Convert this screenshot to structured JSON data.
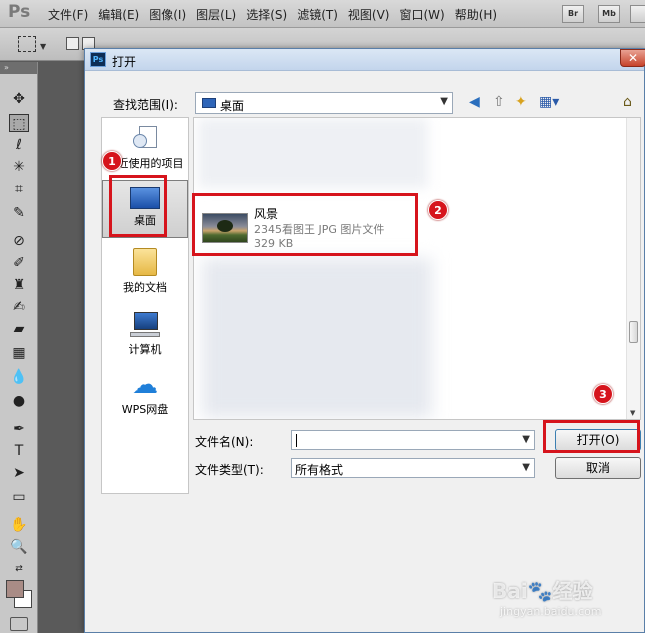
{
  "app": {
    "logo": "Ps",
    "menu": [
      "文件(F)",
      "编辑(E)",
      "图像(I)",
      "图层(L)",
      "选择(S)",
      "滤镜(T)",
      "视图(V)",
      "窗口(W)",
      "帮助(H)"
    ],
    "bridge_button": "Br",
    "minibridge_button": "Mb"
  },
  "dialog": {
    "title": "打开",
    "title_icon": "Ps",
    "close_glyph": "✕",
    "look_in_label": "查找范围(I):",
    "look_in_value": "桌面",
    "places": [
      {
        "label": "最近使用的项目",
        "icon": "recent-icon"
      },
      {
        "label": "桌面",
        "icon": "desktop-icon",
        "selected": true
      },
      {
        "label": "我的文档",
        "icon": "documents-folder-icon"
      },
      {
        "label": "计算机",
        "icon": "computer-icon"
      },
      {
        "label": "WPS网盘",
        "icon": "cloud-icon"
      }
    ],
    "file": {
      "name": "风景",
      "type": "2345看图王 JPG 图片文件",
      "size": "329 KB"
    },
    "file_name_label": "文件名(N):",
    "file_name_value": "",
    "file_type_label": "文件类型(T):",
    "file_type_value": "所有格式",
    "open_button": "打开(O)",
    "cancel_button": "取消"
  },
  "annotations": [
    "1",
    "2",
    "3"
  ],
  "watermark": {
    "main": "Bai🐾经验",
    "sub": "jingyan.baidu.com"
  },
  "colors": {
    "annotation_red": "#d6141c",
    "foreground_swatch": "#a98c86",
    "background_swatch": "#ffffff"
  }
}
